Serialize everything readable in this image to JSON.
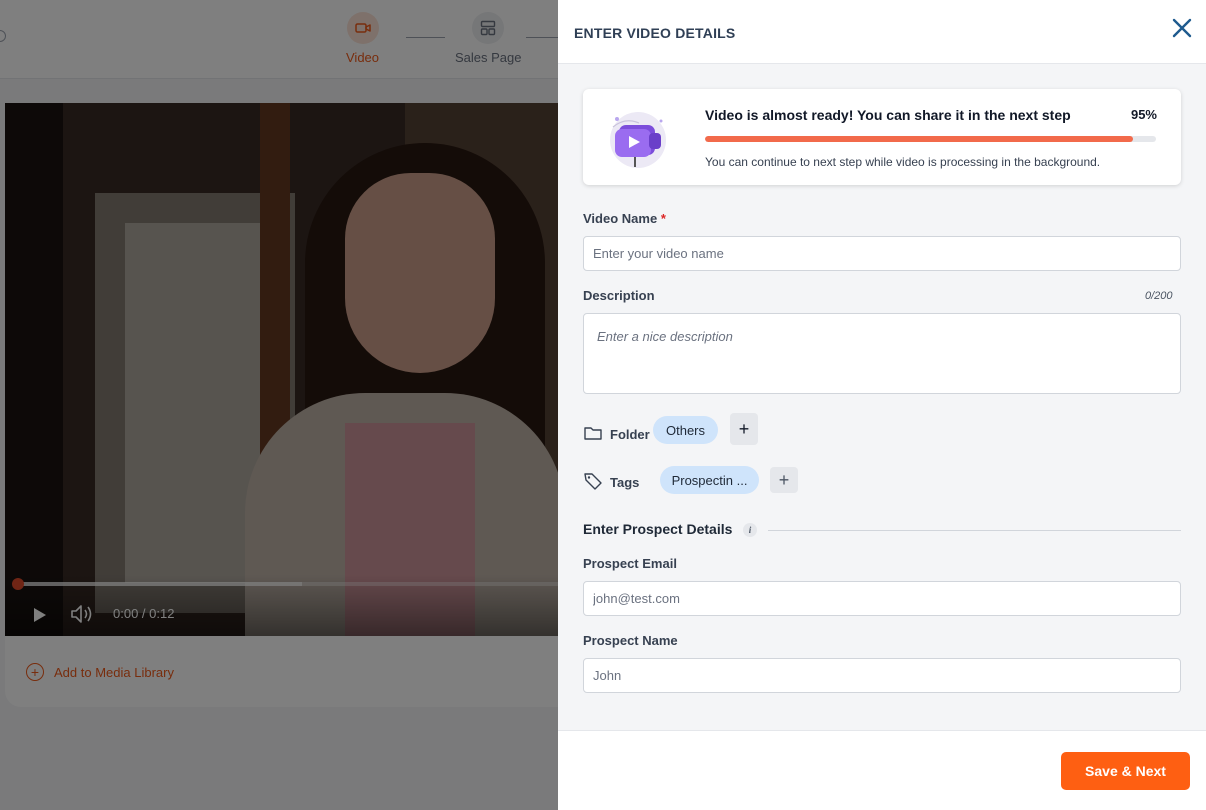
{
  "background": {
    "steps": [
      {
        "label": "Video",
        "icon": "video-camera-icon",
        "state": "active"
      },
      {
        "label": "Sales Page",
        "icon": "layout-grid-icon",
        "state": "inactive"
      }
    ],
    "player": {
      "time": "0:00 / 0:12"
    },
    "add_media_label": "Add to Media Library"
  },
  "drawer": {
    "title": "ENTER VIDEO DETAILS",
    "status": {
      "title": "Video is almost ready! You can share it in the next step",
      "percent_label": "95%",
      "progress": 0.95,
      "subtitle": "You can continue to next step while video is processing in the background."
    },
    "video_name": {
      "label": "Video Name",
      "required_marker": "*",
      "placeholder": "Enter your video name",
      "value": ""
    },
    "description": {
      "label": "Description",
      "counter": "0/200",
      "placeholder": "Enter a nice description",
      "value": ""
    },
    "folder": {
      "label": "Folder",
      "chip": "Others",
      "add": "+"
    },
    "tags": {
      "label": "Tags",
      "chip": "Prospectin ...",
      "add": "+"
    },
    "prospect_section": {
      "title": "Enter Prospect Details",
      "info": "i"
    },
    "prospect_email": {
      "label": "Prospect Email",
      "placeholder": "john@test.com",
      "value": ""
    },
    "prospect_name": {
      "label": "Prospect Name",
      "placeholder": "John",
      "value": ""
    },
    "save_button": "Save & Next"
  },
  "colors": {
    "accent": "#fe5f12",
    "progress": "#f26a4b",
    "chip": "#cfe4fb",
    "title": "#2f3f55"
  }
}
